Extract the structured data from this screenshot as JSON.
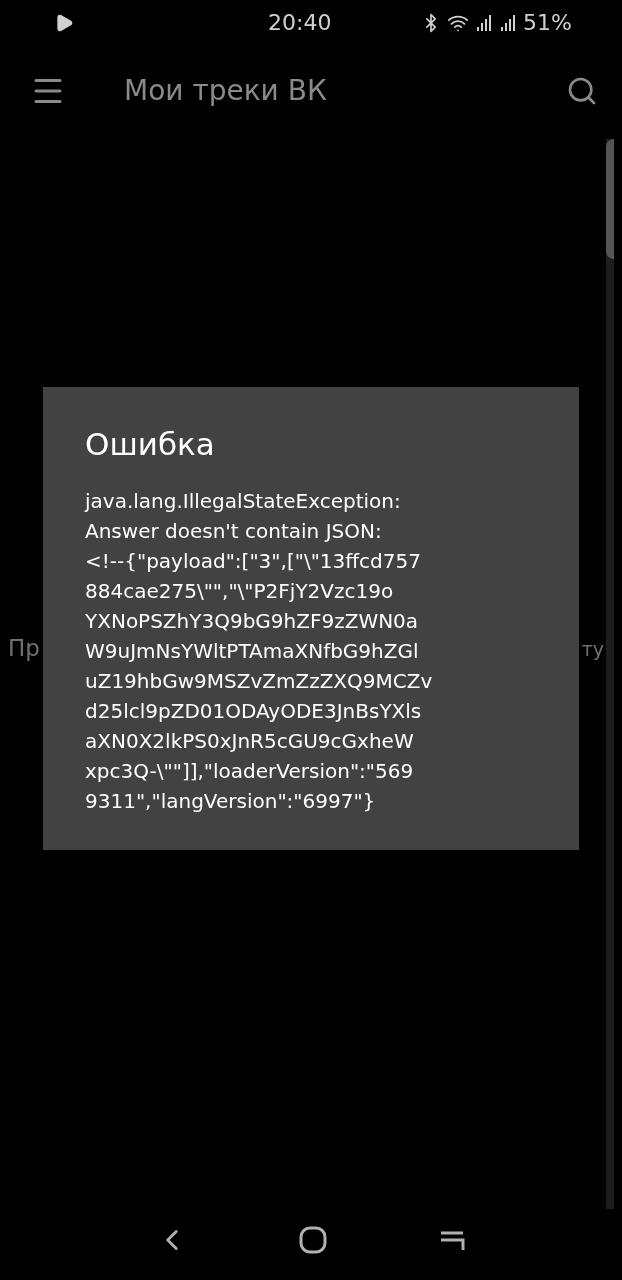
{
  "status_bar": {
    "time": "20:40",
    "battery": "51%"
  },
  "app_bar": {
    "title": "Мои треки ВК"
  },
  "background_text": {
    "left": "Пр",
    "right": "ту"
  },
  "dialog": {
    "title": "Ошибка",
    "message_lines": [
      "java.lang.IllegalStateException:",
      "Answer doesn't contain JSON:",
      "<!--{\"payload\":[\"3\",[\"\\\"13ffcd757",
      "884cae275\\\"\",\"\\\"P2FjY2Vzc19o",
      "YXNoPSZhY3Q9bG9hZF9zZWN0a",
      "W9uJmNsYWltPTAmaXNfbG9hZGl",
      "uZ19hbGw9MSZvZmZzZXQ9MCZv",
      "d25lcl9pZD01ODAyODE3JnBsYXls",
      "aXN0X2lkPS0xJnR5cGU9cGxheW",
      "xpc3Q-\\\"\"]],\"loaderVersion\":\"569",
      "9311\",\"langVersion\":\"6997\"}"
    ]
  }
}
